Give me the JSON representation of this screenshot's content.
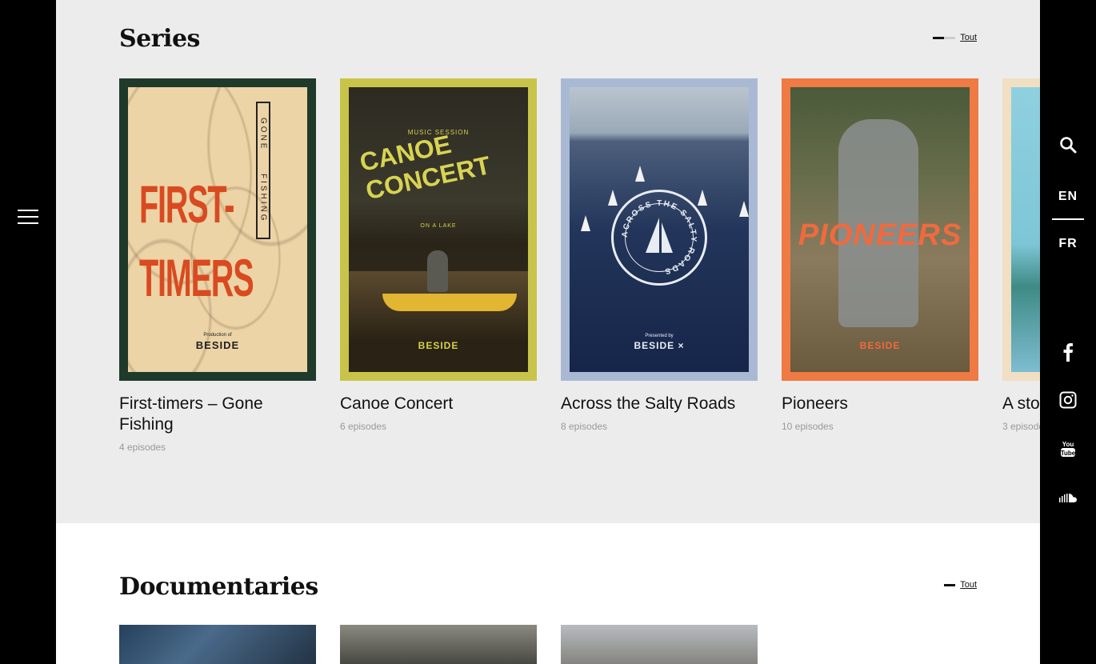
{
  "nav": {
    "menu_icon": "hamburger-icon",
    "search_icon": "search-icon",
    "languages": [
      "EN",
      "FR"
    ],
    "active_language": "EN",
    "social": [
      "facebook-icon",
      "instagram-icon",
      "youtube-icon",
      "soundcloud-icon"
    ]
  },
  "series": {
    "title": "Series",
    "see_all": "Tout",
    "items": [
      {
        "title": "First-timers – Gone Fishing",
        "episodes": "4 episodes",
        "poster": {
          "line1": "FIRST-",
          "line2": "TIMERS",
          "vertical_word1": "GONE",
          "vertical_word2": "FISHING",
          "credit": "Production of",
          "brand": "BESIDE"
        }
      },
      {
        "title": "Canoe Concert",
        "episodes": "6 episodes",
        "poster": {
          "kicker": "MUSIC SESSION",
          "title": "CANOE CONCERT",
          "subtitle": "ON A LAKE",
          "brand": "BESIDE"
        }
      },
      {
        "title": "Across the Salty Roads",
        "episodes": "8 episodes",
        "poster": {
          "seal": "ACROSS THE SALTY ROADS",
          "credit": "Presented by",
          "brand": "BESIDE ×"
        }
      },
      {
        "title": "Pioneers",
        "episodes": "10 episodes",
        "poster": {
          "title": "PIONEERS",
          "brand": "BESIDE"
        }
      },
      {
        "title": "A sto",
        "episodes": "3 episode"
      }
    ]
  },
  "documentaries": {
    "title": "Documentaries",
    "see_all": "Tout"
  },
  "colors": {
    "series_bg": "#ececec",
    "rails": "#000000",
    "poster1_frame": "#1f3a2a",
    "poster2_frame": "#c8c44a",
    "poster3_frame": "#a9b9d4",
    "poster4_frame": "#ef7a44",
    "poster5_frame": "#f0dfc2"
  }
}
